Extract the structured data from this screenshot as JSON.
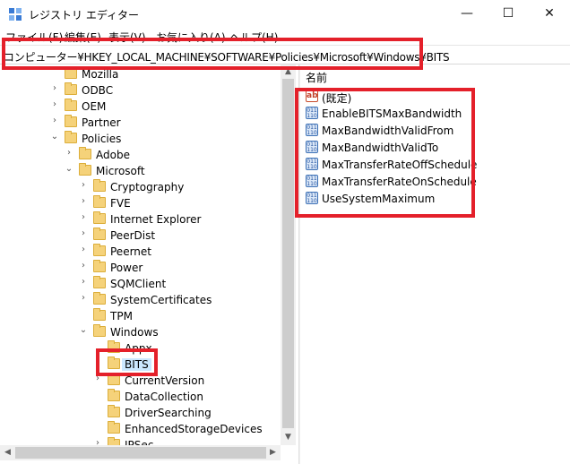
{
  "window": {
    "title": "レジストリ エディター",
    "controls": {
      "minimize": "—",
      "maximize": "☐",
      "close": "✕"
    }
  },
  "menu": [
    "ファイル(F)",
    "編集(E)",
    "表示(V)",
    "お気に入り(A)",
    "ヘルプ(H)"
  ],
  "address": "コンピューター¥HKEY_LOCAL_MACHINE¥SOFTWARE¥Policies¥Microsoft¥Windows¥BITS",
  "tree": {
    "items": [
      {
        "label": "Mozilla",
        "chevron": ""
      },
      {
        "label": "ODBC",
        "chevron": "›"
      },
      {
        "label": "OEM",
        "chevron": "›"
      },
      {
        "label": "Partner",
        "chevron": "›"
      },
      {
        "label": "Policies",
        "chevron": "⌄"
      },
      {
        "label": "Adobe",
        "chevron": "›"
      },
      {
        "label": "Microsoft",
        "chevron": "⌄"
      },
      {
        "label": "Cryptography",
        "chevron": "›"
      },
      {
        "label": "FVE",
        "chevron": "›"
      },
      {
        "label": "Internet Explorer",
        "chevron": "›"
      },
      {
        "label": "PeerDist",
        "chevron": "›"
      },
      {
        "label": "Peernet",
        "chevron": "›"
      },
      {
        "label": "Power",
        "chevron": "›"
      },
      {
        "label": "SQMClient",
        "chevron": "›"
      },
      {
        "label": "SystemCertificates",
        "chevron": "›"
      },
      {
        "label": "TPM",
        "chevron": ""
      },
      {
        "label": "Windows",
        "chevron": "⌄"
      },
      {
        "label": "Appx",
        "chevron": ""
      },
      {
        "label": "BITS",
        "chevron": ""
      },
      {
        "label": "CurrentVersion",
        "chevron": "›"
      },
      {
        "label": "DataCollection",
        "chevron": ""
      },
      {
        "label": "DriverSearching",
        "chevron": ""
      },
      {
        "label": "EnhancedStorageDevices",
        "chevron": ""
      },
      {
        "label": "IPSec",
        "chevron": "›"
      }
    ],
    "selected": "BITS"
  },
  "values": {
    "column_header": "名前",
    "items": [
      {
        "name": "(既定)",
        "icon": "string-value-icon",
        "glyph": "ab"
      },
      {
        "name": "EnableBITSMaxBandwidth",
        "icon": "dword-value-icon",
        "glyph": "011 110"
      },
      {
        "name": "MaxBandwidthValidFrom",
        "icon": "dword-value-icon",
        "glyph": "011 110"
      },
      {
        "name": "MaxBandwidthValidTo",
        "icon": "dword-value-icon",
        "glyph": "011 110"
      },
      {
        "name": "MaxTransferRateOffSchedule",
        "icon": "dword-value-icon",
        "glyph": "011 110"
      },
      {
        "name": "MaxTransferRateOnSchedule",
        "icon": "dword-value-icon",
        "glyph": "011 110"
      },
      {
        "name": "UseSystemMaximum",
        "icon": "dword-value-icon",
        "glyph": "011 110"
      }
    ]
  },
  "colors": {
    "highlight_box": "#e4202a",
    "selection": "#cce8ff",
    "folder": "#f5d27a"
  }
}
